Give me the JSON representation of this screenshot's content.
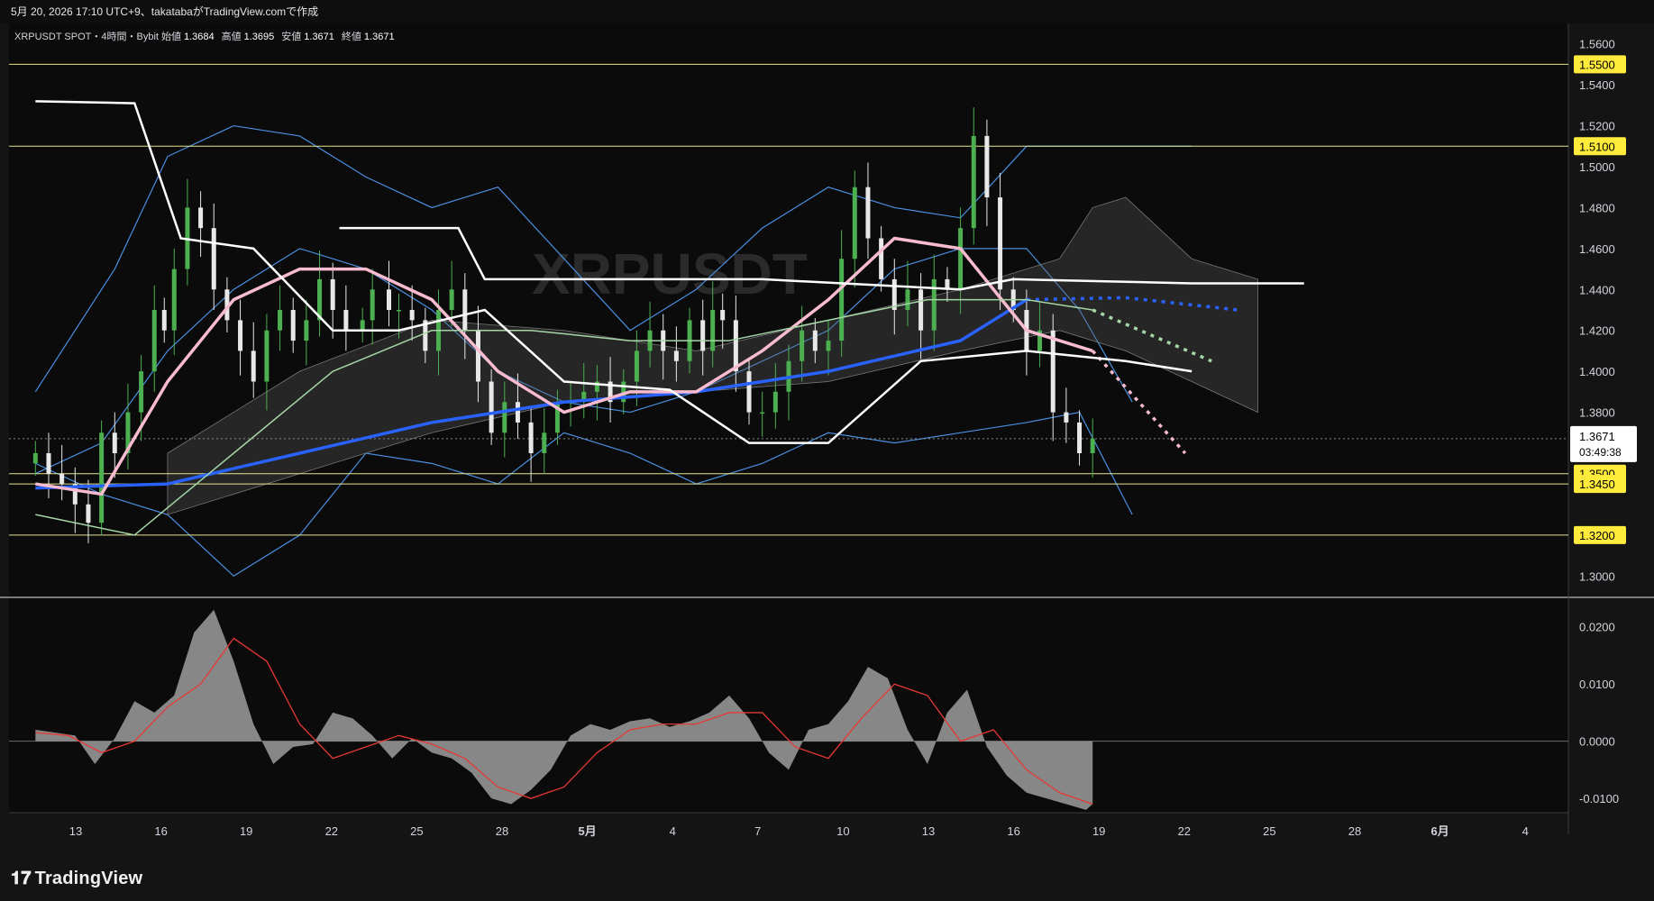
{
  "header": {
    "caption": "5月 20, 2026 17:10 UTC+9、takatabaがTradingView.comで作成"
  },
  "legend": {
    "symbol": "XRPUSDT SPOT・4時間・Bybit",
    "open_label": "始値",
    "open": "1.3684",
    "high_label": "高値",
    "high": "1.3695",
    "low_label": "安値",
    "low": "1.3671",
    "close_label": "終値",
    "close": "1.3671"
  },
  "watermark": {
    "text": "XRPUSDT"
  },
  "last_price": {
    "value": "1.3671",
    "countdown": "03:49:38"
  },
  "brand": {
    "name": "TradingView"
  },
  "colors": {
    "background": "#141414",
    "candle_up": "#4caf50",
    "candle_down": "#e8e8e8",
    "ma_blue": "#2962ff",
    "ma_pink": "#f8bbd0",
    "ma_green": "#a5d6a7",
    "bollinger": "#4a8fe0",
    "level_line": "#e6e38f",
    "level_badge": "#ffeb3b",
    "histogram": "#9e9e9e",
    "signal": "#e53935"
  },
  "chart_data": [
    {
      "type": "candlestick",
      "title": "XRPUSDT SPOT・4時間・Bybit",
      "ylim": [
        1.29,
        1.57
      ],
      "y_ticks": [
        "1.5600",
        "1.5400",
        "1.5200",
        "1.5000",
        "1.4800",
        "1.4600",
        "1.4400",
        "1.4200",
        "1.4000",
        "1.3800",
        "1.3000"
      ],
      "x_ticks": [
        "13",
        "16",
        "19",
        "22",
        "25",
        "28",
        "5月",
        "4",
        "7",
        "10",
        "13",
        "16",
        "19",
        "22",
        "25",
        "28",
        "6月",
        "4"
      ],
      "horizontal_levels": [
        {
          "label": "1.5500",
          "value": 1.55
        },
        {
          "label": "1.5100",
          "value": 1.51
        },
        {
          "label": "1.3500",
          "value": 1.35
        },
        {
          "label": "1.3450",
          "value": 1.345
        },
        {
          "label": "1.3200",
          "value": 1.32
        }
      ],
      "price_series": {
        "day": [
          0,
          2,
          4,
          6,
          8,
          10,
          12,
          14,
          16,
          18,
          19.5,
          21,
          23,
          25,
          27,
          29,
          31,
          33,
          35,
          37,
          39,
          41,
          43,
          45,
          47,
          49.5,
          51,
          53.5,
          55,
          57,
          59,
          61,
          63,
          65,
          67,
          69,
          71,
          73,
          75,
          77,
          79,
          81,
          83,
          85,
          87,
          89,
          91,
          93,
          95,
          97,
          99,
          101,
          102.5,
          104,
          106,
          108,
          110,
          112,
          114,
          116,
          118,
          120,
          122,
          124,
          126,
          128,
          130,
          132,
          134,
          136,
          138,
          140,
          142,
          144,
          146,
          148,
          150,
          152,
          154,
          156,
          158,
          160
        ],
        "close": [
          1.36,
          1.35,
          1.345,
          1.335,
          1.326,
          1.37,
          1.36,
          1.38,
          1.4,
          1.43,
          1.42,
          1.45,
          1.48,
          1.47,
          1.44,
          1.425,
          1.41,
          1.395,
          1.42,
          1.43,
          1.415,
          1.425,
          1.445,
          1.43,
          1.42,
          1.425,
          1.44,
          1.43,
          1.43,
          1.425,
          1.41,
          1.43,
          1.44,
          1.42,
          1.395,
          1.37,
          1.385,
          1.375,
          1.36,
          1.37,
          1.385,
          1.385,
          1.39,
          1.395,
          1.385,
          1.395,
          1.41,
          1.42,
          1.41,
          1.405,
          1.425,
          1.41,
          1.43,
          1.425,
          1.4,
          1.38,
          1.38,
          1.39,
          1.405,
          1.42,
          1.41,
          1.415,
          1.455,
          1.49,
          1.465,
          1.445,
          1.43,
          1.44,
          1.42,
          1.445,
          1.44,
          1.47,
          1.515,
          1.485,
          1.44,
          1.43,
          1.41,
          1.42,
          1.38,
          1.375,
          1.36,
          1.367
        ]
      },
      "series": [
        {
          "name": "",
          "kind": "moving_average_200",
          "color": "#2962ff",
          "day": [
            0,
            20,
            40,
            60,
            80,
            100,
            120,
            140,
            150
          ],
          "values": [
            1.343,
            1.345,
            1.36,
            1.375,
            1.385,
            1.39,
            1.4,
            1.415,
            1.435
          ],
          "forecast_day": [
            150,
            165,
            182
          ],
          "forecast_values": [
            1.435,
            1.436,
            1.43
          ]
        },
        {
          "name": "",
          "kind": "moving_average_pink",
          "color": "#f8bbd0",
          "day": [
            0,
            10,
            20,
            30,
            40,
            50,
            60,
            70,
            80,
            90,
            100,
            110,
            120,
            130,
            140,
            150,
            160
          ],
          "values": [
            1.345,
            1.34,
            1.395,
            1.435,
            1.45,
            1.45,
            1.435,
            1.4,
            1.38,
            1.39,
            1.39,
            1.41,
            1.435,
            1.465,
            1.46,
            1.42,
            1.41
          ],
          "forecast_day": [
            160,
            174
          ],
          "forecast_values": [
            1.41,
            1.36
          ]
        },
        {
          "name": "",
          "kind": "moving_average_green",
          "color": "#a5d6a7",
          "day": [
            0,
            15,
            30,
            45,
            60,
            75,
            90,
            105,
            120,
            135,
            150,
            160
          ],
          "values": [
            1.33,
            1.32,
            1.36,
            1.4,
            1.42,
            1.42,
            1.415,
            1.415,
            1.425,
            1.435,
            1.435,
            1.43
          ],
          "forecast_day": [
            160,
            178
          ],
          "forecast_values": [
            1.43,
            1.405
          ]
        },
        {
          "name": "",
          "kind": "step_line",
          "color": "#ffffff",
          "points": [
            [
              0,
              1.532
            ],
            [
              15,
              1.531
            ],
            [
              22,
              1.465
            ],
            [
              33,
              1.46
            ],
            [
              45,
              1.42
            ],
            [
              55,
              1.42
            ],
            [
              68,
              1.43
            ],
            [
              80,
              1.395
            ],
            [
              96,
              1.391
            ],
            [
              108,
              1.365
            ],
            [
              120,
              1.365
            ],
            [
              134,
              1.405
            ],
            [
              150,
              1.41
            ],
            [
              165,
              1.405
            ],
            [
              175,
              1.4
            ]
          ]
        },
        {
          "name": "",
          "kind": "step_line_upper",
          "color": "#ffffff",
          "points": [
            [
              46,
              1.47
            ],
            [
              57,
              1.47
            ],
            [
              64,
              1.47
            ],
            [
              68,
              1.445
            ],
            [
              110,
              1.445
            ],
            [
              140,
              1.44
            ],
            [
              148,
              1.445
            ],
            [
              175,
              1.443
            ],
            [
              192,
              1.443
            ]
          ]
        }
      ]
    },
    {
      "type": "histogram",
      "title": "",
      "ylim": [
        -0.0125,
        0.025
      ],
      "y_ticks": [
        "0.0200",
        "0.0100",
        "0.0000",
        "-0.0100"
      ],
      "series": [
        {
          "name": "",
          "kind": "histogram",
          "day": [
            0,
            3,
            6,
            9,
            12,
            15,
            18,
            21,
            24,
            27,
            30,
            33,
            36,
            39,
            42,
            45,
            48,
            51,
            54,
            57,
            60,
            63,
            66,
            69,
            72,
            75,
            78,
            81,
            84,
            87,
            90,
            93,
            96,
            99,
            102,
            105,
            108,
            111,
            114,
            117,
            120,
            123,
            126,
            129,
            132,
            135,
            138,
            141,
            144,
            147,
            150,
            153,
            156,
            159,
            160
          ],
          "values": [
            0.002,
            0.0015,
            0.001,
            -0.004,
            0.0005,
            0.007,
            0.005,
            0.008,
            0.019,
            0.023,
            0.014,
            0.003,
            -0.004,
            -0.001,
            -0.0005,
            0.005,
            0.004,
            0.001,
            -0.003,
            0.0005,
            -0.002,
            -0.003,
            -0.0055,
            -0.01,
            -0.011,
            -0.0085,
            -0.005,
            0.001,
            0.003,
            0.002,
            0.0035,
            0.004,
            0.0025,
            0.0035,
            0.005,
            0.008,
            0.004,
            -0.002,
            -0.005,
            0.002,
            0.003,
            0.007,
            0.013,
            0.011,
            0.002,
            -0.004,
            0.005,
            0.009,
            -0.001,
            -0.006,
            -0.009,
            -0.01,
            -0.011,
            -0.012,
            -0.011
          ]
        },
        {
          "name": "",
          "kind": "signal_line",
          "color": "#e53935",
          "day": [
            0,
            5,
            10,
            15,
            20,
            25,
            30,
            35,
            40,
            45,
            50,
            55,
            60,
            65,
            70,
            75,
            80,
            85,
            90,
            95,
            100,
            105,
            110,
            115,
            120,
            125,
            130,
            135,
            140,
            145,
            150,
            155,
            160
          ],
          "values": [
            0.0015,
            0.001,
            -0.002,
            0.0,
            0.006,
            0.01,
            0.018,
            0.014,
            0.003,
            -0.003,
            -0.001,
            0.001,
            -0.0005,
            -0.003,
            -0.008,
            -0.01,
            -0.008,
            -0.002,
            0.002,
            0.003,
            0.003,
            0.005,
            0.005,
            -0.001,
            -0.003,
            0.004,
            0.01,
            0.008,
            0.0,
            0.002,
            -0.005,
            -0.009,
            -0.011
          ]
        }
      ]
    }
  ]
}
